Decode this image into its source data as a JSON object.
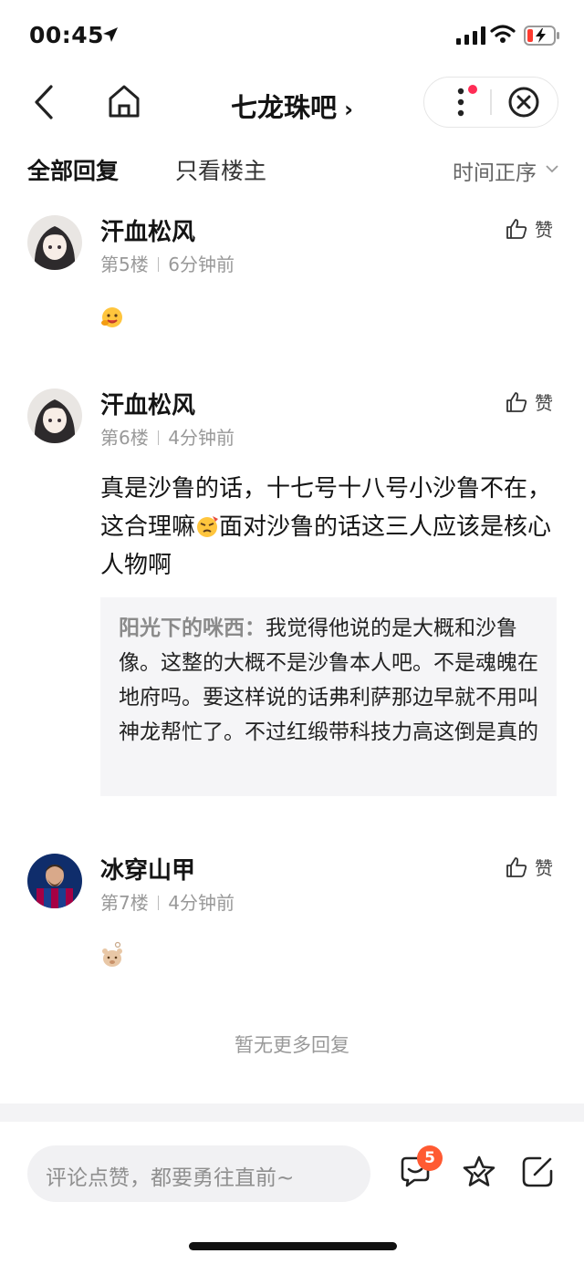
{
  "status_bar": {
    "time": "00:45"
  },
  "nav": {
    "title": "七龙珠吧",
    "title_chevron": "›"
  },
  "tabs": {
    "all": "全部回复",
    "op_only": "只看楼主",
    "sort": "时间正序"
  },
  "comments": [
    {
      "username": "汗血松风",
      "floor": "第5楼",
      "time_ago": "6分钟前",
      "like_label": "赞",
      "text": ""
    },
    {
      "username": "汗血松风",
      "floor": "第6楼",
      "time_ago": "4分钟前",
      "like_label": "赞",
      "text": "真是沙鲁的话，十七号十八号小沙鲁不在，这合理嘛",
      "text_after_emoji": "面对沙鲁的话这三人应该是核心人物啊",
      "quote_name": "阳光下的咪西：",
      "quote_text": "我觉得他说的是大概和沙鲁像。这整的大概不是沙鲁本人吧。不是魂魄在地府吗。要这样说的话弗利萨那边早就不用叫神龙帮忙了。不过红缎带科技力高这倒是真的"
    },
    {
      "username": "冰穿山甲",
      "floor": "第7楼",
      "time_ago": "4分钟前",
      "like_label": "赞",
      "text": ""
    }
  ],
  "footer_note": "暂无更多回复",
  "bottom_bar": {
    "placeholder": "评论点赞，都要勇往直前~",
    "message_count": "5"
  },
  "colors": {
    "badge": "#ff5a32",
    "red_dot": "#ff2c55",
    "text_primary": "#141414",
    "text_secondary": "#999999"
  },
  "icons": [
    "location-arrow-icon",
    "signal-icon",
    "wifi-icon",
    "battery-charging-icon",
    "back-icon",
    "home-icon",
    "more-icon",
    "close-icon",
    "chevron-down-icon",
    "thumbs-up-icon",
    "emoji-icon",
    "message-icon",
    "star-icon",
    "share-icon"
  ]
}
